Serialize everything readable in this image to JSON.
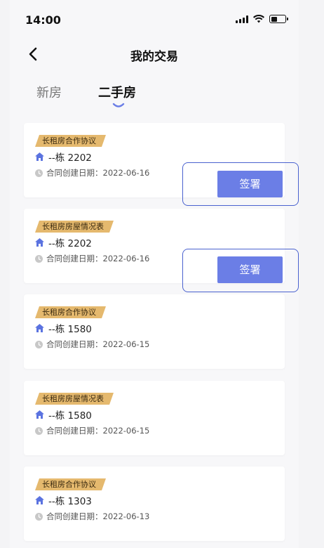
{
  "status_bar": {
    "time": "14:00"
  },
  "nav": {
    "title": "我的交易"
  },
  "tabs": [
    {
      "label": "新房",
      "active": false
    },
    {
      "label": "二手房",
      "active": true
    }
  ],
  "sign_label": "签署",
  "cards": [
    {
      "tag": "长租房合作协议",
      "address": "--栋 2202",
      "date": "合同创建日期：2022-06-16",
      "has_sign": true
    },
    {
      "tag": "长租房房屋情况表",
      "address": "--栋 2202",
      "date": "合同创建日期：2022-06-16",
      "has_sign": true
    },
    {
      "tag": "长租房合作协议",
      "address": "--栋 1580",
      "date": "合同创建日期：2022-06-15",
      "has_sign": false
    },
    {
      "tag": "长租房房屋情况表",
      "address": "--栋 1580",
      "date": "合同创建日期：2022-06-15",
      "has_sign": false
    },
    {
      "tag": "长租房合作协议",
      "address": "--栋 1303",
      "date": "合同创建日期：2022-06-13",
      "has_sign": false
    }
  ],
  "colors": {
    "accent": "#6b7ee6",
    "tag_bg": "#e5b96e",
    "highlight_border": "#4a62cf",
    "house_icon": "#5b73e0"
  },
  "icons": {
    "back": "chevron-left-icon",
    "house": "house-icon",
    "clock": "clock-icon",
    "signal": "signal-icon",
    "wifi": "wifi-icon",
    "battery": "battery-icon"
  }
}
